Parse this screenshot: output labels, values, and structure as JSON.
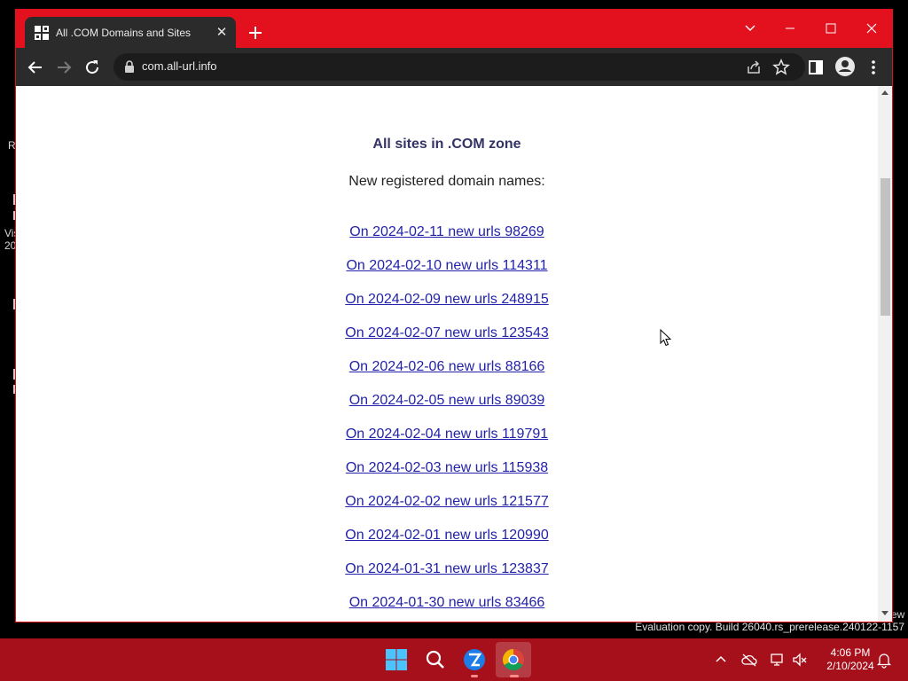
{
  "desktop": {
    "fragments": [
      "R",
      "Vis",
      "20"
    ],
    "watermark": "Evaluation copy. Build 26040.rs_prerelease.240122-1157",
    "watermark_fragment": "ew"
  },
  "browser": {
    "tab_title": "All .COM Domains and Sites",
    "url": "com.all-url.info"
  },
  "page": {
    "title": "All sites in .COM zone",
    "subtitle": "New registered domain names:",
    "links": [
      "On 2024-02-11 new urls 98269",
      "On 2024-02-10 new urls 114311",
      "On 2024-02-09 new urls 248915",
      "On 2024-02-07 new urls 123543",
      "On 2024-02-06 new urls 88166",
      "On 2024-02-05 new urls 89039",
      "On 2024-02-04 new urls 119791",
      "On 2024-02-03 new urls 115938",
      "On 2024-02-02 new urls 121577",
      "On 2024-02-01 new urls 120990",
      "On 2024-01-31 new urls 123837",
      "On 2024-01-30 new urls 83466"
    ]
  },
  "taskbar": {
    "time": "4:06 PM",
    "date": "2/10/2024"
  },
  "colors": {
    "titlebar": "#e3101e",
    "taskbar": "#a5101b",
    "toolbar": "#2b2b2b",
    "link": "#2222aa",
    "heading": "#333366"
  }
}
